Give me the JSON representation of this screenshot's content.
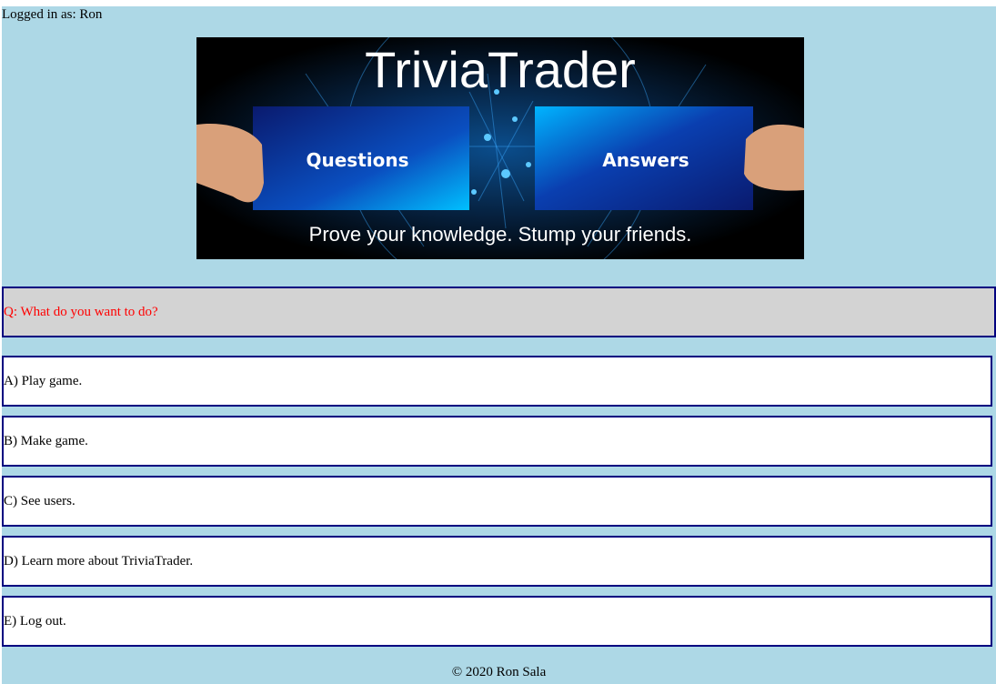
{
  "header": {
    "logged_in": "Logged in as: Ron"
  },
  "banner": {
    "title": "TriviaTrader",
    "left_card": "Questions",
    "right_card": "Answers",
    "tagline": "Prove your knowledge. Stump your friends."
  },
  "question": "Q: What do you want to do?",
  "answers": [
    "A) Play game.",
    "B) Make game.",
    "C) See users.",
    "D) Learn more about TriviaTrader.",
    "E) Log out."
  ],
  "footer": "© 2020 Ron Sala"
}
